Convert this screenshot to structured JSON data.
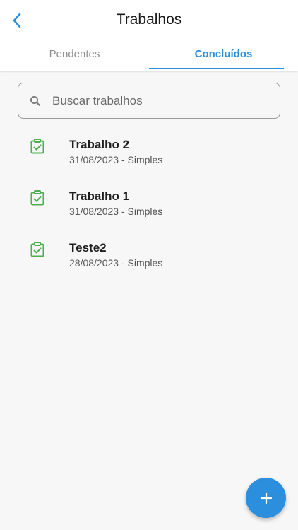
{
  "header": {
    "title": "Trabalhos",
    "back_icon": "chevron-left-icon"
  },
  "tabs": [
    {
      "label": "Pendentes",
      "active": false
    },
    {
      "label": "Concluídos",
      "active": true
    }
  ],
  "search": {
    "placeholder": "Buscar trabalhos",
    "value": "",
    "icon": "search-icon"
  },
  "jobs": [
    {
      "title": "Trabalho 2",
      "subtitle": "31/08/2023 - Simples",
      "icon": "clipboard-check-icon"
    },
    {
      "title": "Trabalho 1",
      "subtitle": "31/08/2023 - Simples",
      "icon": "clipboard-check-icon"
    },
    {
      "title": "Teste2",
      "subtitle": "28/08/2023 - Simples",
      "icon": "clipboard-check-icon"
    }
  ],
  "fab": {
    "icon": "plus-icon"
  },
  "colors": {
    "accent": "#2b8fde",
    "success": "#4caf50",
    "background": "#f7f7f7"
  }
}
